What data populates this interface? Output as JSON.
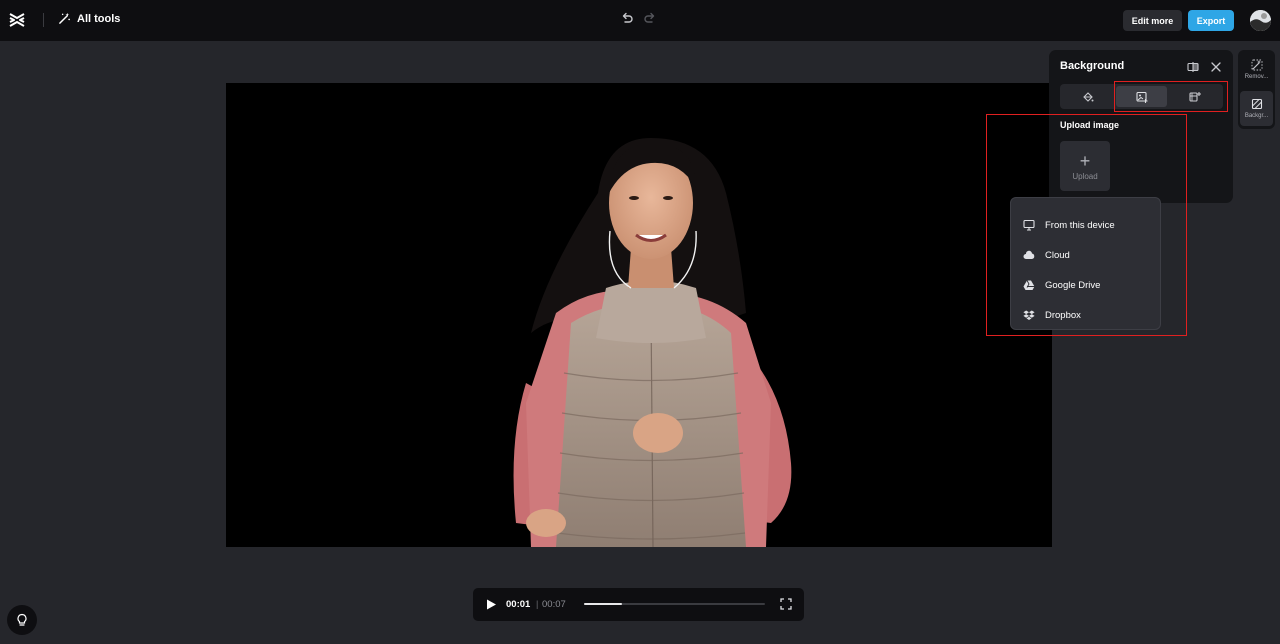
{
  "header": {
    "all_tools_label": "All tools",
    "edit_more_label": "Edit more",
    "export_label": "Export"
  },
  "background_panel": {
    "title": "Background",
    "tabs": [
      {
        "icon": "paint-bucket-icon",
        "active": false
      },
      {
        "icon": "image-add-icon",
        "active": true
      },
      {
        "icon": "template-icon",
        "active": false
      }
    ],
    "upload_section_label": "Upload image",
    "upload_button_label": "Upload"
  },
  "upload_menu": {
    "items": [
      {
        "label": "From this device",
        "icon": "monitor-icon"
      },
      {
        "label": "Cloud",
        "icon": "cloud-icon"
      },
      {
        "label": "Google Drive",
        "icon": "google-drive-icon"
      },
      {
        "label": "Dropbox",
        "icon": "dropbox-icon"
      }
    ]
  },
  "right_rail": {
    "items": [
      {
        "label": "Remov...",
        "icon": "remove-background-icon"
      },
      {
        "label": "Backgr...",
        "icon": "background-icon",
        "active": true
      }
    ]
  },
  "player": {
    "current_time": "00:01",
    "separator": "|",
    "total_time": "00:07",
    "progress_fraction": 0.21
  },
  "colors": {
    "accent": "#2ea6e6",
    "highlight": "#e02020",
    "top_bar": "#0e0e11",
    "workspace": "#25262b"
  }
}
